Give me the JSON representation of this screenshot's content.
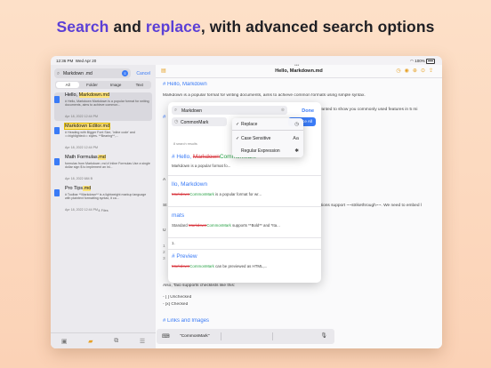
{
  "headline": {
    "part1": "Search",
    "part2": " and ",
    "part3": "replace",
    "part4": ", with advanced search options"
  },
  "status": {
    "time": "12:36 PM",
    "date": "Wed Apr 20",
    "battery": "100%"
  },
  "sidebar": {
    "search_query": "Markdown .md",
    "cancel_label": "Cancel",
    "filters": [
      "All",
      "Folder",
      "Image",
      "Text"
    ],
    "results": [
      {
        "title_pre": "Hello, ",
        "title_hl": "Markdown.md",
        "snippet": "# Hello, Markdown Markdown is a popular format for writing documents, aims to achieve common...",
        "date": "Apr 18, 2022 12:44 PM"
      },
      {
        "title_pre": "",
        "title_hl": "Markdown Editor.md",
        "snippet": "# Heading with Bigger Font Size, 'inline code' and ==highlighted== styles. **Bearing**,...",
        "date": "Apr 18, 2022 12:44 PM"
      },
      {
        "title_pre": "Math Formulas",
        "title_hl": ".md",
        "snippet": "formulas from Markdown .md # Inline Formulas Use a single dollar sign $ to implement an inl...",
        "date": "Apr 18, 2022 684 B"
      },
      {
        "title_pre": "Pro Tips",
        "title_hl": ".md",
        "snippet": "# Toolbar **Markdown** is a lightweight markup language with plaintext formatting syntax, it ca...",
        "date": "Apr 18, 2022 12:44 PM"
      }
    ],
    "files_count": "4 Files"
  },
  "editor": {
    "nav_title": "Hello, Markdown.md",
    "heading": "# Hello, Markdown",
    "intro": "Markdown is a popular format for writing documents, aims to achieve common formats using simple syntax.",
    "right_frag1": "wanted to show you commonly used features in 5 mi",
    "right_frag2": "ations support ~~strikethrough~~. We need to embed l",
    "frag_h": "#",
    "frag_u": "U",
    "frag_a": "A",
    "frag_st": "St",
    "also_line": "Also, Taio supports checklists like this:",
    "check1": "- [ ] Unchecked",
    "check2": "- [x] Checked",
    "links_heading": "# Links and Images",
    "code_lines": [
      "1",
      "2",
      "3"
    ]
  },
  "find_panel": {
    "find_query": "Markdown",
    "replace_text": "CommonMark",
    "done_label": "Done",
    "replace_all_label": "Replace All",
    "result_count": "8 search results",
    "matches": [
      {
        "heading_pre": "# Hello, ",
        "del": "Markdown",
        "ins": "CommonMark",
        "text": "Markdown is a popular format fo..."
      },
      {
        "heading_pre": "llo, Markdown",
        "del": "",
        "ins": "",
        "text_del": "Markdown",
        "text_ins": "CommonMark",
        "text_post": " is a popular format for wr..."
      },
      {
        "heading_pre": "mats",
        "del": "",
        "ins": "",
        "text_pre": "Standard ",
        "text_del": "Markdown",
        "text_ins": "CommonMark",
        "text_post": " supports **Bold** and *Ita..."
      },
      {
        "heading_pre": "",
        "del": "",
        "ins": "",
        "text": "1."
      },
      {
        "heading_pre": "# Preview",
        "del": "",
        "ins": "",
        "text_del": "Markdown",
        "text_ins": "CommonMark",
        "text_post": " can be previewed as HTML,..."
      }
    ]
  },
  "options_menu": {
    "items": [
      {
        "label": "Replace",
        "checked": "✓",
        "shortcut": "◷"
      },
      {
        "label": "Case Sensitive",
        "checked": "✓",
        "shortcut": "Aa"
      },
      {
        "label": "Regular Expression",
        "checked": "",
        "shortcut": "✱"
      }
    ]
  },
  "bottom_bar": {
    "suggestion": "\"CommonMark\""
  },
  "icons": {
    "search": "search-icon",
    "mic": "microphone-icon",
    "keyboard": "keyboard-icon"
  },
  "colors": {
    "accent": "#5b3fd6",
    "ios_blue": "#3a7bf6",
    "highlight": "#ffe47a",
    "deleted": "#d9363e",
    "inserted": "#29a146"
  }
}
